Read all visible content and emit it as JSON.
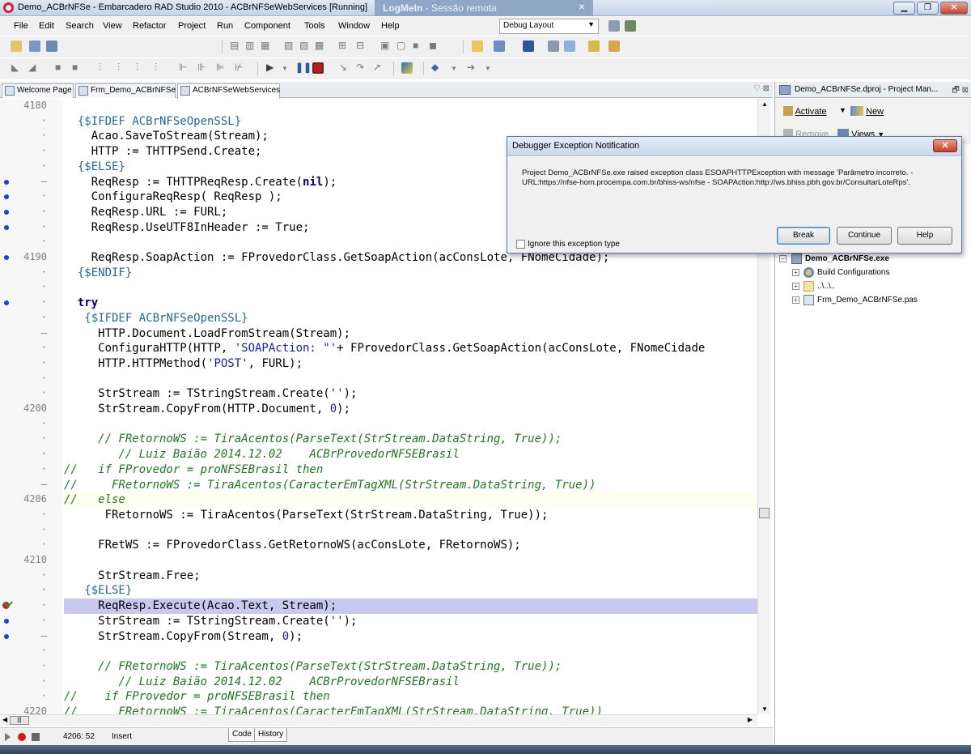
{
  "window": {
    "title": "Demo_ACBrNFSe - Embarcadero RAD Studio 2010 - ACBrNFSeWebServices [Running]",
    "logmein_brand": "LogMeIn",
    "logmein_session": "- Sessão remota",
    "logmein_close": "×"
  },
  "menu": {
    "items": [
      "File",
      "Edit",
      "Search",
      "View",
      "Refactor",
      "Project",
      "Run",
      "Component",
      "Tools",
      "Window",
      "Help"
    ],
    "layout_combo": "Debug Layout"
  },
  "editor_tabs": [
    "Welcome Page",
    "Frm_Demo_ACBrNFSe",
    "ACBrNFSeWebServices"
  ],
  "gutter": [
    {
      "num": "4180",
      "mark": "",
      "dot": false
    },
    {
      "num": "",
      "mark": "·",
      "dot": false
    },
    {
      "num": "",
      "mark": "·",
      "dot": false
    },
    {
      "num": "",
      "mark": "·",
      "dot": false
    },
    {
      "num": "",
      "mark": "·",
      "dot": false
    },
    {
      "num": "",
      "mark": "–",
      "dot": true
    },
    {
      "num": "",
      "mark": "·",
      "dot": true
    },
    {
      "num": "",
      "mark": "·",
      "dot": true
    },
    {
      "num": "",
      "mark": "·",
      "dot": true
    },
    {
      "num": "",
      "mark": "·",
      "dot": false
    },
    {
      "num": "4190",
      "mark": "",
      "dot": true
    },
    {
      "num": "",
      "mark": "·",
      "dot": false
    },
    {
      "num": "",
      "mark": "·",
      "dot": false
    },
    {
      "num": "",
      "mark": "·",
      "dot": true
    },
    {
      "num": "",
      "mark": "·",
      "dot": false
    },
    {
      "num": "",
      "mark": "–",
      "dot": false
    },
    {
      "num": "",
      "mark": "·",
      "dot": false
    },
    {
      "num": "",
      "mark": "·",
      "dot": false
    },
    {
      "num": "",
      "mark": "·",
      "dot": false
    },
    {
      "num": "",
      "mark": "·",
      "dot": false
    },
    {
      "num": "4200",
      "mark": "",
      "dot": false
    },
    {
      "num": "",
      "mark": "·",
      "dot": false
    },
    {
      "num": "",
      "mark": "·",
      "dot": false
    },
    {
      "num": "",
      "mark": "·",
      "dot": false
    },
    {
      "num": "",
      "mark": "·",
      "dot": false
    },
    {
      "num": "",
      "mark": "–",
      "dot": false
    },
    {
      "num": "4206",
      "mark": "",
      "dot": false
    },
    {
      "num": "",
      "mark": "·",
      "dot": false
    },
    {
      "num": "",
      "mark": "·",
      "dot": false
    },
    {
      "num": "",
      "mark": "·",
      "dot": false
    },
    {
      "num": "4210",
      "mark": "",
      "dot": false
    },
    {
      "num": "",
      "mark": "·",
      "dot": false
    },
    {
      "num": "",
      "mark": "·",
      "dot": false
    },
    {
      "num": "",
      "mark": "·",
      "dot": false,
      "bp": true
    },
    {
      "num": "",
      "mark": "·",
      "dot": true
    },
    {
      "num": "",
      "mark": "–",
      "dot": true
    },
    {
      "num": "",
      "mark": "·",
      "dot": false
    },
    {
      "num": "",
      "mark": "·",
      "dot": false
    },
    {
      "num": "",
      "mark": "·",
      "dot": false
    },
    {
      "num": "",
      "mark": "·",
      "dot": false
    },
    {
      "num": "4220",
      "mark": "",
      "dot": false
    }
  ],
  "code": [
    {
      "t": "",
      "c": ""
    },
    {
      "t": "  {$IFDEF ACBrNFSeOpenSSL}",
      "c": "directive"
    },
    {
      "t": "    Acao.SaveToStream(Stream);",
      "c": ""
    },
    {
      "t": "    HTTP := THTTPSend.Create;",
      "c": ""
    },
    {
      "t": "  {$ELSE}",
      "c": "directive"
    },
    {
      "t": "    ReqResp := THTTPReqResp.Create(nil);",
      "c": "nil"
    },
    {
      "t": "    ConfiguraReqResp( ReqResp );",
      "c": ""
    },
    {
      "t": "    ReqResp.URL := FURL;",
      "c": ""
    },
    {
      "t": "    ReqResp.UseUTF8InHeader := True;",
      "c": ""
    },
    {
      "t": "",
      "c": ""
    },
    {
      "t": "    ReqResp.SoapAction := FProvedorClass.GetSoapAction(acConsLote, FNomeCidade);",
      "c": ""
    },
    {
      "t": "  {$ENDIF}",
      "c": "directive"
    },
    {
      "t": "",
      "c": ""
    },
    {
      "t": "  try",
      "c": "kwline"
    },
    {
      "t": "   {$IFDEF ACBrNFSeOpenSSL}",
      "c": "directive"
    },
    {
      "t": "     HTTP.Document.LoadFromStream(Stream);",
      "c": ""
    },
    {
      "t": "     ConfiguraHTTP(HTTP, 'SOAPAction: \"'+ FProvedorClass.GetSoapAction(acConsLote, FNomeCidade",
      "c": ""
    },
    {
      "t": "     HTTP.HTTPMethod('POST', FURL);",
      "c": ""
    },
    {
      "t": "",
      "c": ""
    },
    {
      "t": "     StrStream := TStringStream.Create('');",
      "c": ""
    },
    {
      "t": "     StrStream.CopyFrom(HTTP.Document, 0);",
      "c": ""
    },
    {
      "t": "",
      "c": ""
    },
    {
      "t": "     // FRetornoWS := TiraAcentos(ParseText(StrStream.DataString, True));",
      "c": "comment"
    },
    {
      "t": "        // Luiz Baião 2014.12.02    ACBrProvedorNFSEBrasil",
      "c": "comment"
    },
    {
      "t": "//   if FProvedor = proNFSEBrasil then",
      "c": "comment"
    },
    {
      "t": "//     FRetornoWS := TiraAcentos(CaracterEmTagXML(StrStream.DataString, True))",
      "c": "comment"
    },
    {
      "t": "//   else",
      "c": "comment cur"
    },
    {
      "t": "      FRetornoWS := TiraAcentos(ParseText(StrStream.DataString, True));",
      "c": ""
    },
    {
      "t": "",
      "c": ""
    },
    {
      "t": "     FRetWS := FProvedorClass.GetRetornoWS(acConsLote, FRetornoWS);",
      "c": ""
    },
    {
      "t": "",
      "c": ""
    },
    {
      "t": "     StrStream.Free;",
      "c": ""
    },
    {
      "t": "   {$ELSE}",
      "c": "directive"
    },
    {
      "t": "     ReqResp.Execute(Acao.Text, Stream);",
      "c": "hl"
    },
    {
      "t": "     StrStream := TStringStream.Create('');",
      "c": ""
    },
    {
      "t": "     StrStream.CopyFrom(Stream, 0);",
      "c": ""
    },
    {
      "t": "",
      "c": ""
    },
    {
      "t": "     // FRetornoWS := TiraAcentos(ParseText(StrStream.DataString, True));",
      "c": "comment"
    },
    {
      "t": "        // Luiz Baião 2014.12.02    ACBrProvedorNFSEBrasil",
      "c": "comment"
    },
    {
      "t": "//    if FProvedor = proNFSEBrasil then",
      "c": "comment"
    },
    {
      "t": "//      FRetornoWS := TiraAcentos(CaracterEmTagXML(StrStream.DataString, True))",
      "c": "comment"
    }
  ],
  "status": {
    "position": "4206: 52",
    "mode": "Insert",
    "tab_code": "Code",
    "tab_history": "History"
  },
  "project_manager": {
    "title": "Demo_ACBrNFSe.dproj - Project Man...",
    "activate": "Activate",
    "new": "New",
    "remove": "Remove",
    "views": "Views",
    "tree": [
      {
        "label": "Demo_ACBrNFSe.exe",
        "bold": true
      },
      {
        "label": "Build Configurations",
        "bold": false
      },
      {
        "label": "..\\..\\..",
        "bold": false
      },
      {
        "label": "Frm_Demo_ACBrNFSe.pas",
        "bold": false
      }
    ]
  },
  "dialog": {
    "title": "Debugger Exception Notification",
    "message": "Project Demo_ACBrNFSe.exe raised exception class ESOAPHTTPException with message 'Parâmetro incorreto. - URL:https://nfse-hom.procempa.com.br/bhiss-ws/nfse - SOAPAction:http://ws.bhiss.pbh.gov.br/ConsultarLoteRps'.",
    "ignore_label": "Ignore this exception type",
    "break": "Break",
    "continue": "Continue",
    "help": "Help"
  }
}
